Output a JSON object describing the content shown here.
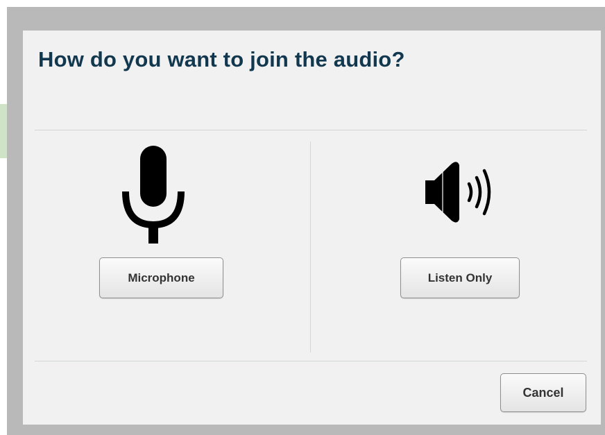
{
  "dialog": {
    "title": "How do you want to join the audio?",
    "options": {
      "microphone": {
        "label": "Microphone",
        "icon": "microphone-icon"
      },
      "listen_only": {
        "label": "Listen Only",
        "icon": "speaker-icon"
      }
    },
    "cancel_label": "Cancel"
  },
  "colors": {
    "title": "#12384f",
    "modal_background": "#f1f1f1",
    "frame": "#b9b9b9",
    "icon": "#000000"
  }
}
